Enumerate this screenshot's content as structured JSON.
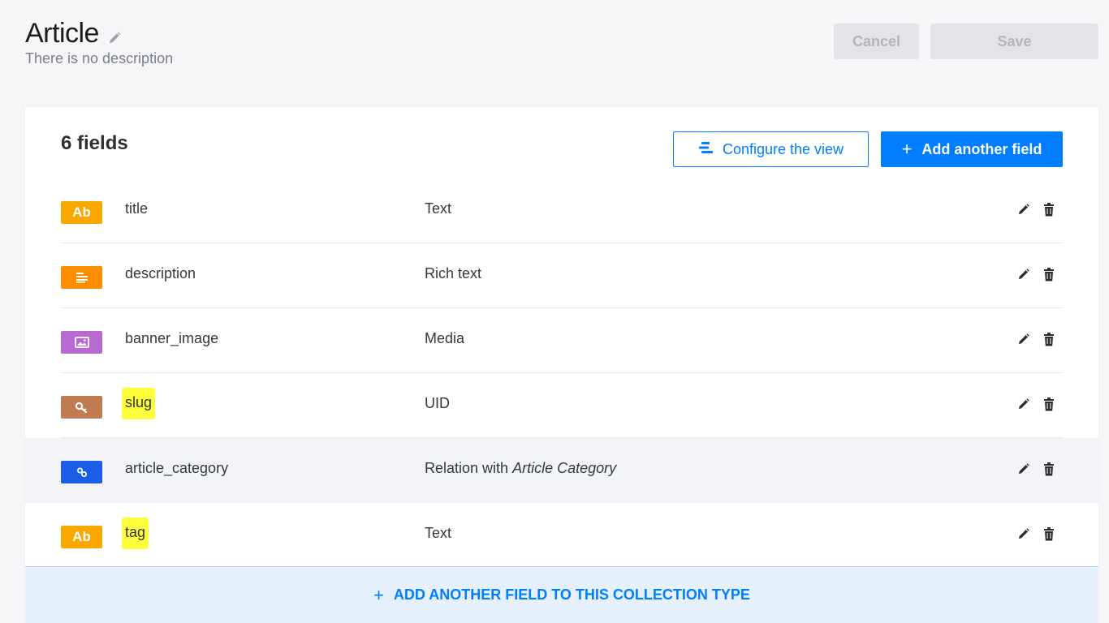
{
  "header": {
    "title": "Article",
    "description": "There is no description",
    "cancel_label": "Cancel",
    "save_label": "Save"
  },
  "card": {
    "fields_count": "6 fields",
    "configure_label": "Configure the view",
    "add_field_label": "Add another field",
    "add_field_plus": "+",
    "bottom_label": "ADD ANOTHER FIELD TO THIS COLLECTION TYPE",
    "bottom_plus": "+"
  },
  "fields": [
    {
      "name": "title",
      "type": "Text",
      "badge": "Ab",
      "icon": "text-icon",
      "color": "#faa700"
    },
    {
      "name": "description",
      "type": "Rich text",
      "badge": "",
      "icon": "richtext-icon",
      "color": "#ff8d00"
    },
    {
      "name": "banner_image",
      "type": "Media",
      "badge": "",
      "icon": "image-icon",
      "color": "#b86ad3"
    },
    {
      "name": "slug",
      "type": "UID",
      "badge": "",
      "icon": "key-icon",
      "color": "#c07c50"
    },
    {
      "name": "article_category",
      "type": "Relation with",
      "type_em": "Article Category",
      "badge": "",
      "icon": "link-icon",
      "color": "#1c5de7"
    },
    {
      "name": "tag",
      "type": "Text",
      "badge": "Ab",
      "icon": "text-icon",
      "color": "#faa700"
    }
  ],
  "colors": {
    "primary": "#007eff",
    "highlight": "#fcff3a"
  }
}
